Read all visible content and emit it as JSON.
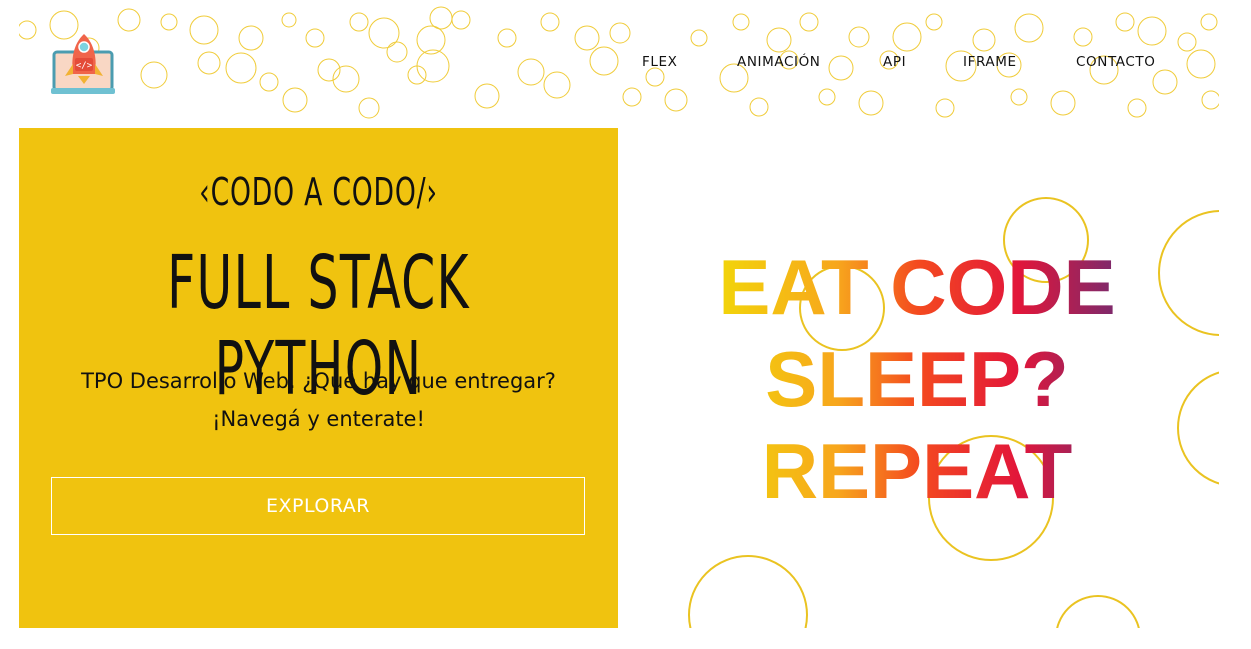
{
  "header": {
    "logo_icon": "rocket-code-icon",
    "nav": [
      {
        "label": "FLEX"
      },
      {
        "label": "ANIMACIÓN"
      },
      {
        "label": "API"
      },
      {
        "label": "IFRAME"
      },
      {
        "label": "CONTACTO"
      }
    ]
  },
  "hero": {
    "subtitle": "‹CODO A CODO/›",
    "title": "FULL STACK PYTHON",
    "description_line1": "TPO Desarrollo Web. ¿Qué hay que entregar?",
    "description_line2": "¡Navegá y enterate!",
    "explore_label": "EXPLORAR"
  },
  "slogan": {
    "line1": "EAT CODE",
    "line2": "SLEEP?",
    "line3": "REPEAT"
  },
  "colors": {
    "accent_yellow": "#f0c30f",
    "circle_stroke": "#eac321",
    "slogan_gradient": [
      "#f2d50a",
      "#f7a61d",
      "#f44a1f",
      "#e2163a",
      "#7a2a6d"
    ]
  }
}
